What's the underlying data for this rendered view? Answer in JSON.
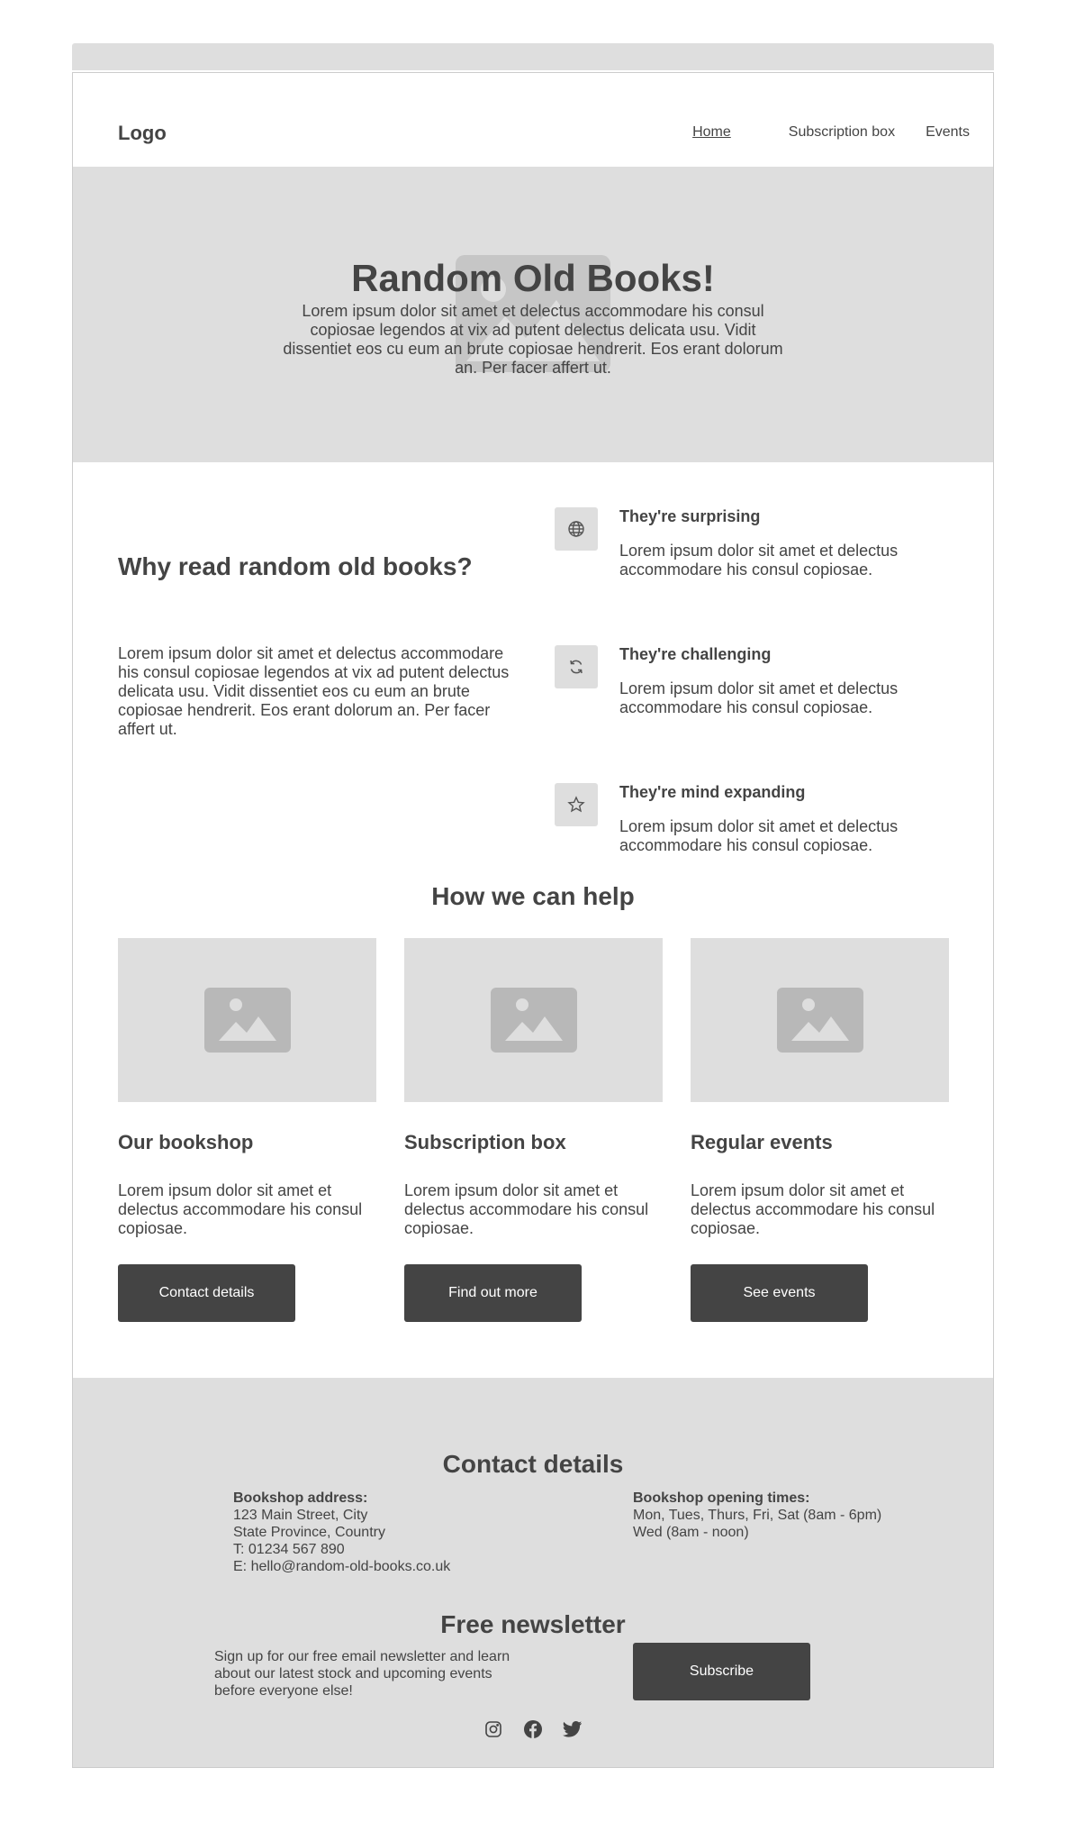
{
  "header": {
    "logo": "Logo",
    "nav": [
      "Home",
      "Subscription box",
      "Events"
    ]
  },
  "hero": {
    "title": "Random Old Books!",
    "text": "Lorem ipsum dolor sit amet et delectus accommodare his consul copiosae legendos at vix ad putent delectus delicata usu. Vidit dissentiet eos cu eum an brute copiosae hendrerit. Eos erant dolorum an. Per facer affert ut."
  },
  "why": {
    "title": "Why read random old books?",
    "text": "Lorem ipsum dolor sit amet et delectus accommodare his consul copiosae legendos at vix ad putent delectus delicata usu. Vidit dissentiet eos cu eum an brute copiosae hendrerit. Eos erant dolorum an. Per facer affert ut.",
    "features": [
      {
        "icon": "globe-icon",
        "title": "They're surprising",
        "text": "Lorem ipsum dolor sit amet et delectus accommodare his consul copiosae."
      },
      {
        "icon": "refresh-icon",
        "title": "They're challenging",
        "text": "Lorem ipsum dolor sit amet et delectus accommodare his consul copiosae."
      },
      {
        "icon": "star-icon",
        "title": "They're mind expanding",
        "text": "Lorem ipsum dolor sit amet et delectus accommodare his consul copiosae."
      }
    ]
  },
  "how": {
    "title": "How we can help",
    "cards": [
      {
        "title": "Our bookshop",
        "text": "Lorem ipsum dolor sit amet et delectus accommodare his consul copiosae.",
        "button": "Contact details"
      },
      {
        "title": "Subscription box",
        "text": "Lorem ipsum dolor sit amet et delectus accommodare his consul copiosae.",
        "button": "Find out more"
      },
      {
        "title": "Regular events",
        "text": "Lorem ipsum dolor sit amet et delectus accommodare his consul copiosae.",
        "button": "See events"
      }
    ]
  },
  "footer": {
    "contact_title": "Contact details",
    "address_label": "Bookshop address:",
    "address_lines": [
      "123 Main Street, City",
      "State Province, Country",
      "T: 01234 567 890",
      "E: hello@random-old-books.co.uk"
    ],
    "hours_label": "Bookshop opening times:",
    "hours_lines": [
      "Mon, Tues, Thurs, Fri, Sat (8am - 6pm)",
      "Wed (8am - noon)"
    ],
    "newsletter_title": "Free newsletter",
    "newsletter_text": "Sign up for our free email newsletter and learn about our latest stock and upcoming events before everyone else!",
    "subscribe": "Subscribe",
    "social": [
      "instagram-icon",
      "facebook-icon",
      "twitter-icon"
    ]
  },
  "colors": {
    "dark": "#444444",
    "placeholder_gray": "#dedede",
    "image_icon_gray": "#b8b8b8"
  }
}
